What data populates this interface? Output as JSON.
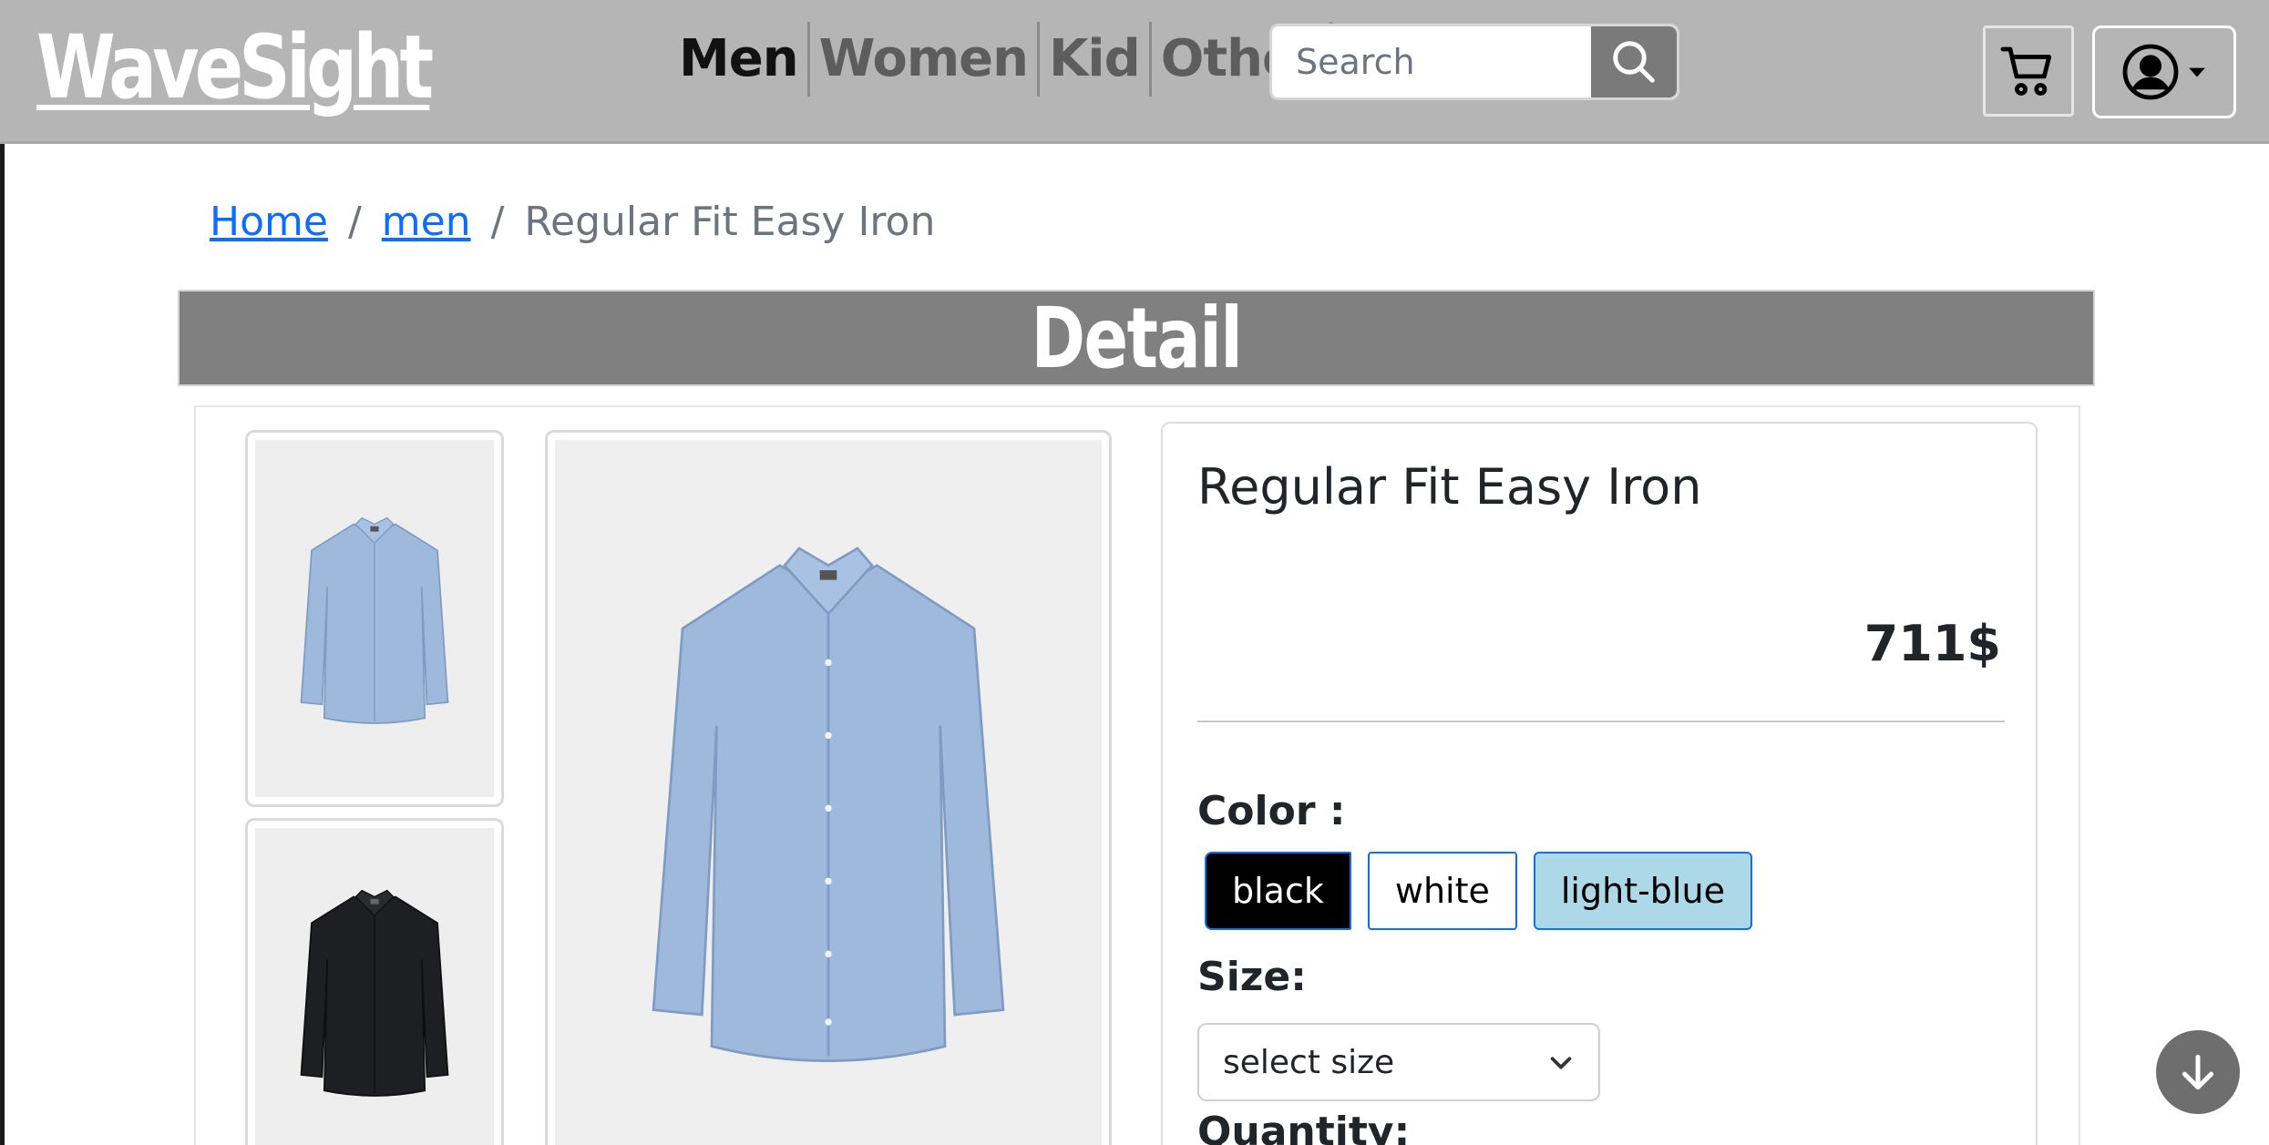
{
  "brand": {
    "logo_text": "WaveSight"
  },
  "nav": {
    "items": [
      {
        "label": "Men"
      },
      {
        "label": "Women"
      },
      {
        "label": "Kid"
      },
      {
        "label": "Other"
      }
    ]
  },
  "search": {
    "placeholder": "Search",
    "value": ""
  },
  "icons": {
    "search": "search-icon",
    "cart": "cart-icon",
    "user": "user-circle-icon",
    "caret": "caret-down-icon",
    "scroll": "arrow-down-icon",
    "chevron": "chevron-down-icon"
  },
  "breadcrumb": {
    "home": "Home",
    "category": "men",
    "current": "Regular Fit Easy Iron",
    "separator": "/"
  },
  "detail": {
    "heading": "Detail"
  },
  "product": {
    "title": "Regular Fit Easy Iron",
    "price": "711$",
    "color_label": "Color :",
    "colors": [
      "black",
      "white",
      "light-blue"
    ],
    "size_label": "Size:",
    "size_select": "select size",
    "quantity_label": "Quantity:"
  },
  "colors": {
    "header_bg": "#b5b5b5",
    "banner_bg": "#808080",
    "link": "#0d6efd",
    "shirt_blue": "#9fb9dc",
    "shirt_black": "#1e1f22"
  }
}
